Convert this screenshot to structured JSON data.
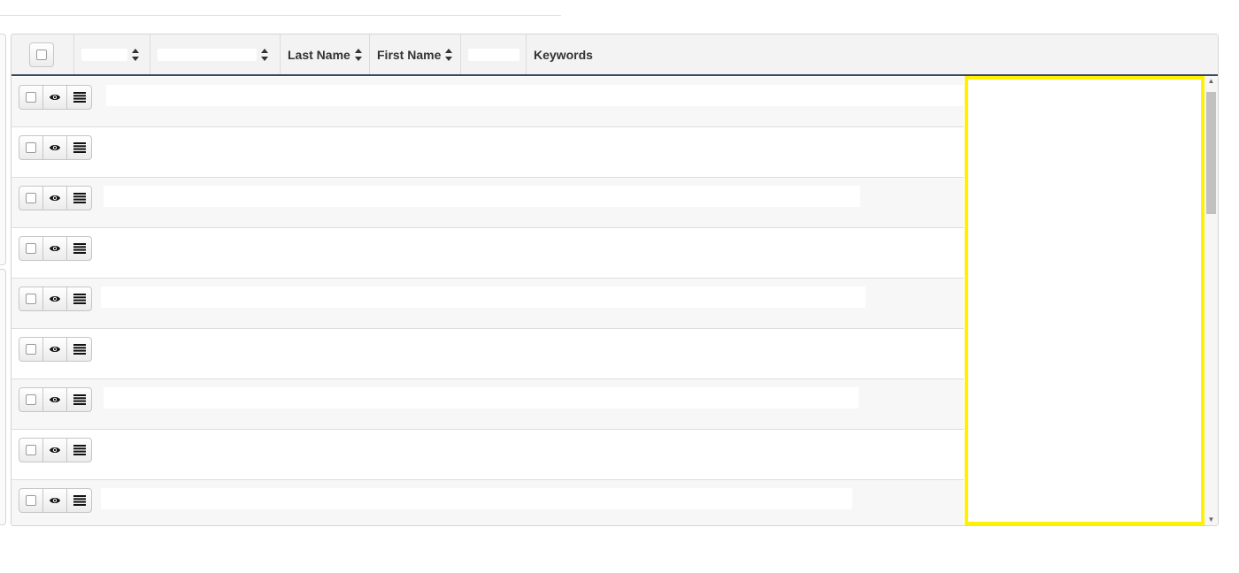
{
  "header": {
    "last_name": "Last Name",
    "first_name": "First Name",
    "keywords": "Keywords"
  },
  "rows": [
    {
      "content": ""
    },
    {
      "content": ""
    },
    {
      "content": ""
    },
    {
      "content": ""
    },
    {
      "content": ""
    },
    {
      "content": ""
    },
    {
      "content": ""
    },
    {
      "content": ""
    },
    {
      "content": ""
    }
  ],
  "icons": {
    "select": "checkbox-icon",
    "view": "eye-icon",
    "details": "list-icon",
    "sort": "sort-icon"
  },
  "colors": {
    "header_border": "#39475c",
    "highlight": "#fff200"
  }
}
